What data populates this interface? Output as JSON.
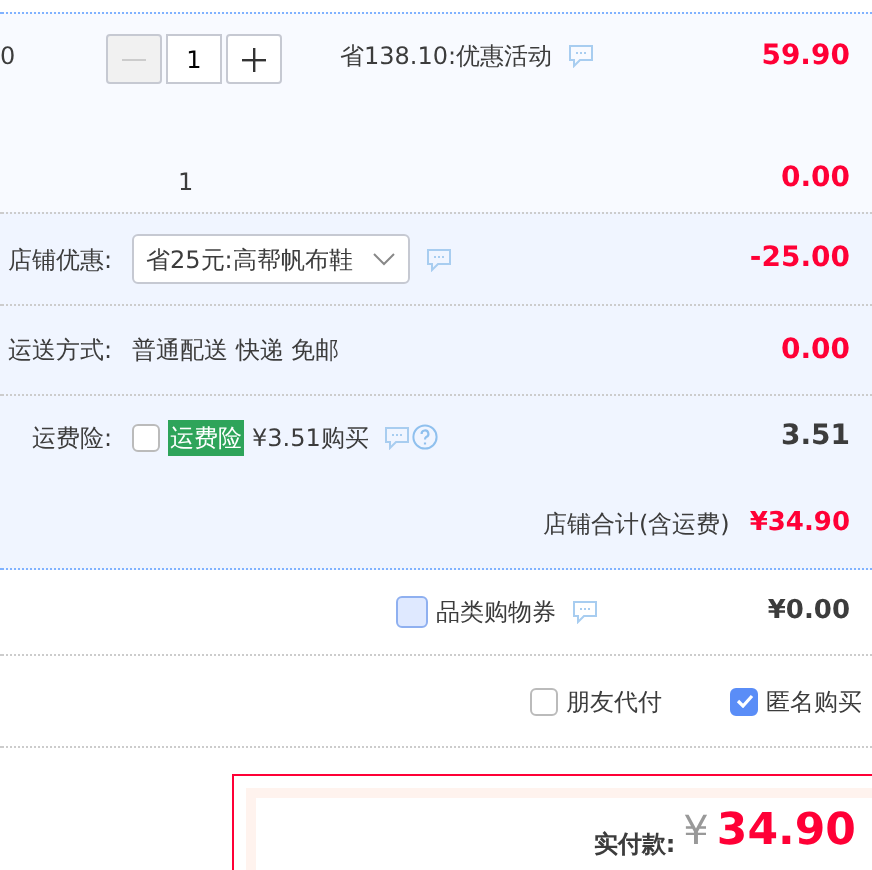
{
  "item": {
    "column_1": "0",
    "quantity": "1",
    "promo": "省138.10:优惠活动",
    "price": "59.90",
    "sub_quantity": "1",
    "sub_price": "0.00"
  },
  "shop_rows": [
    {
      "kind": "select",
      "label": "店铺优惠:",
      "value": "省25元:高帮帆布鞋",
      "amount": "-25.00"
    },
    {
      "kind": "text",
      "label": "运送方式:",
      "value": "普通配送 快递 免邮",
      "amount": "0.00"
    },
    {
      "kind": "insurance",
      "label": "运费险:",
      "checked": false,
      "tag": "运费险",
      "value": "¥3.51购买",
      "amount": "3.51"
    }
  ],
  "shop_total": {
    "label": "店铺合计(含运费)",
    "amount": "¥34.90"
  },
  "coupon": {
    "label": "品类购物券",
    "checked": false,
    "amount": "¥0.00"
  },
  "options": [
    {
      "label": "朋友代付",
      "checked": false
    },
    {
      "label": "匿名购买",
      "checked": true
    }
  ],
  "payment": {
    "label": "实付款:",
    "currency": "¥",
    "amount": "34.90"
  }
}
